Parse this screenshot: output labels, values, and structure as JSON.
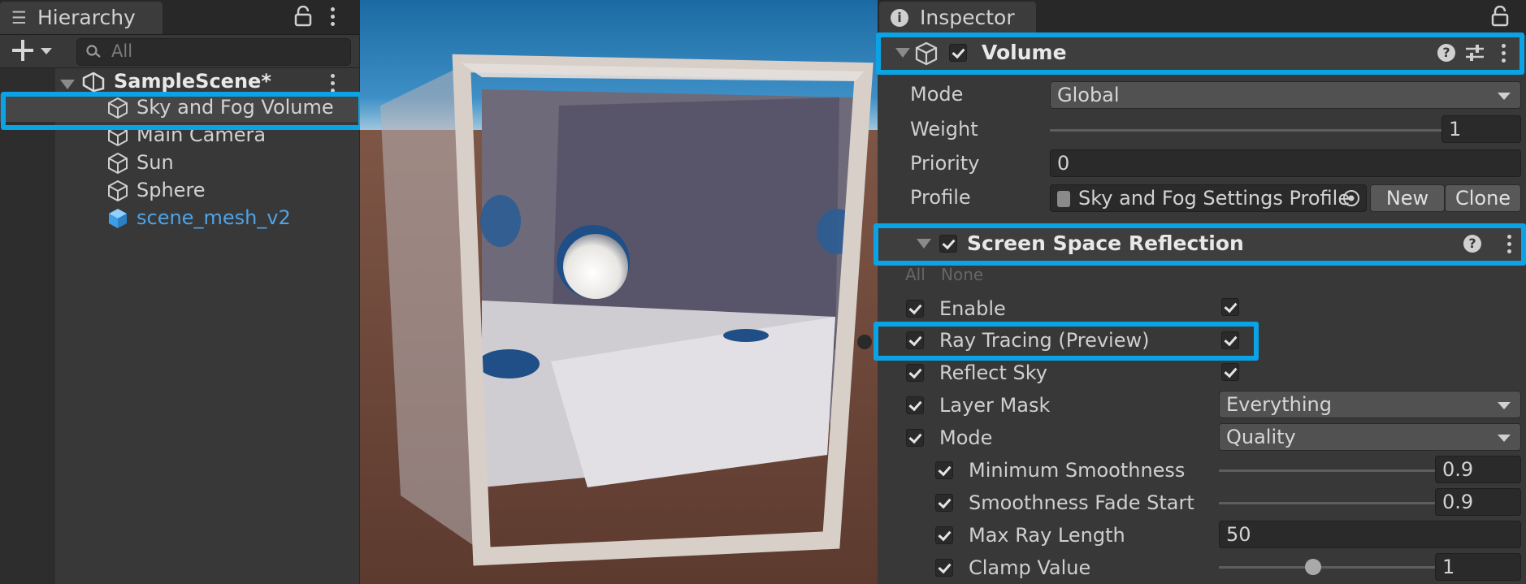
{
  "hierarchy": {
    "tab_label": "Hierarchy",
    "search_placeholder": "All",
    "scene_name": "SampleScene*",
    "items": [
      {
        "label": "Sky and Fog Volume"
      },
      {
        "label": "Main Camera"
      },
      {
        "label": "Sun"
      },
      {
        "label": "Sphere"
      },
      {
        "label": "scene_mesh_v2"
      }
    ],
    "prefab_color": "#4fa3e6"
  },
  "inspector": {
    "tab_label": "Inspector",
    "component_title": "Volume",
    "mode_label": "Mode",
    "mode_value": "Global",
    "weight_label": "Weight",
    "weight_value": "1",
    "weight_fraction": 1.0,
    "priority_label": "Priority",
    "priority_value": "0",
    "profile_label": "Profile",
    "profile_value": "Sky and Fog Settings Profile",
    "new_button": "New",
    "clone_button": "Clone",
    "override_title": "Screen Space Reflection",
    "all_label": "All",
    "none_label": "None",
    "props": {
      "enable": "Enable",
      "ray_tracing": "Ray Tracing (Preview)",
      "reflect_sky": "Reflect Sky",
      "layer_mask": "Layer Mask",
      "layer_mask_value": "Everything",
      "mode": "Mode",
      "mode_value": "Quality",
      "min_smoothness": "Minimum Smoothness",
      "min_smoothness_value": "0.9",
      "min_smoothness_fraction": 0.9,
      "fade_start": "Smoothness Fade Start",
      "fade_start_value": "0.9",
      "fade_start_fraction": 0.9,
      "max_ray_length": "Max Ray Length",
      "max_ray_length_value": "50",
      "clamp_value": "Clamp Value",
      "clamp_value_value": "1",
      "clamp_fraction": 0.35
    }
  },
  "colors": {
    "highlight": "#0aa4e6",
    "panel": "#383838",
    "sky_top": "#1f6fa8",
    "ground": "#6a4638"
  }
}
